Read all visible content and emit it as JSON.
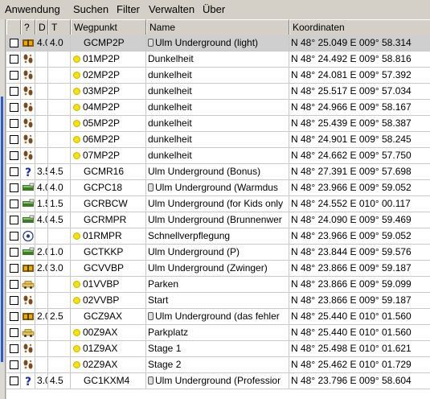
{
  "menu": [
    "Anwendung",
    "Suchen",
    "Filter",
    "Verwalten",
    "Über"
  ],
  "columns": [
    "?",
    "D",
    "T",
    "Wegpunkt",
    "Name",
    "Koordinaten"
  ],
  "rows": [
    {
      "icon": "traditional-cache-icon",
      "d": "4.0",
      "t": "4.0",
      "dot": false,
      "lock": true,
      "wp": "GCMP2P",
      "name": "Ulm Underground (light)",
      "coord": "N 48° 25.049 E 009° 58.314",
      "selected": true
    },
    {
      "icon": "footprints-icon",
      "d": "",
      "t": "",
      "dot": true,
      "lock": false,
      "wp": "01MP2P",
      "name": "Dunkelheit",
      "coord": "N 48° 24.492 E 009° 58.816",
      "selected": false
    },
    {
      "icon": "footprints-icon",
      "d": "",
      "t": "",
      "dot": true,
      "lock": false,
      "wp": "02MP2P",
      "name": "dunkelheit",
      "coord": "N 48° 24.081 E 009° 57.392",
      "selected": false
    },
    {
      "icon": "footprints-icon",
      "d": "",
      "t": "",
      "dot": true,
      "lock": false,
      "wp": "03MP2P",
      "name": "dunkelheit",
      "coord": "N 48° 25.517 E 009° 57.034",
      "selected": false
    },
    {
      "icon": "footprints-icon",
      "d": "",
      "t": "",
      "dot": true,
      "lock": false,
      "wp": "04MP2P",
      "name": "dunkelheit",
      "coord": "N 48° 24.966 E 009° 58.167",
      "selected": false
    },
    {
      "icon": "footprints-icon",
      "d": "",
      "t": "",
      "dot": true,
      "lock": false,
      "wp": "05MP2P",
      "name": "dunkelheit",
      "coord": "N 48° 25.439 E 009° 58.387",
      "selected": false
    },
    {
      "icon": "footprints-icon",
      "d": "",
      "t": "",
      "dot": true,
      "lock": false,
      "wp": "06MP2P",
      "name": "dunkelheit",
      "coord": "N 48° 24.901 E 009° 58.245",
      "selected": false
    },
    {
      "icon": "footprints-icon",
      "d": "",
      "t": "",
      "dot": true,
      "lock": false,
      "wp": "07MP2P",
      "name": "dunkelheit",
      "coord": "N 48° 24.662 E 009° 57.750",
      "selected": false
    },
    {
      "icon": "mystery-cache-icon",
      "d": "3.5",
      "t": "4.5",
      "dot": false,
      "lock": false,
      "wp": "GCMR16",
      "name": "Ulm Underground (Bonus)",
      "coord": "N 48° 27.391 E 009° 57.698",
      "selected": false
    },
    {
      "icon": "multi-cache-icon",
      "d": "4.0",
      "t": "4.0",
      "dot": false,
      "lock": true,
      "wp": "GCPC18",
      "name": "Ulm Underground (Warmdus",
      "coord": "N 48° 23.966 E 009° 59.052",
      "selected": false
    },
    {
      "icon": "multi-cache-icon",
      "d": "1.5",
      "t": "1.5",
      "dot": false,
      "lock": false,
      "wp": "GCRBCW",
      "name": "Ulm Underground (for Kids only",
      "coord": "N 48° 24.552 E 010° 00.117",
      "selected": false
    },
    {
      "icon": "multi-cache-icon",
      "d": "4.0",
      "t": "4.5",
      "dot": false,
      "lock": false,
      "wp": "GCRMPR",
      "name": "Ulm Underground (Brunnenwer",
      "coord": "N 48° 24.090 E 009° 59.469",
      "selected": false
    },
    {
      "icon": "reference-point-icon",
      "d": "",
      "t": "",
      "dot": true,
      "lock": false,
      "wp": "01RMPR",
      "name": "Schnellverpflegung",
      "coord": "N 48° 23.966 E 009° 59.052",
      "selected": false
    },
    {
      "icon": "multi-cache-icon",
      "d": "2.0",
      "t": "1.0",
      "dot": false,
      "lock": false,
      "wp": "GCTKKP",
      "name": "Ulm Underground (P)",
      "coord": "N 48° 23.844 E 009° 59.576",
      "selected": false
    },
    {
      "icon": "traditional-cache-icon",
      "d": "2.0",
      "t": "3.0",
      "dot": false,
      "lock": false,
      "wp": "GCVVBP",
      "name": "Ulm Underground (Zwinger)",
      "coord": "N 48° 23.866 E 009° 59.187",
      "selected": false
    },
    {
      "icon": "parking-car-icon",
      "d": "",
      "t": "",
      "dot": true,
      "lock": false,
      "wp": "01VVBP",
      "name": "Parken",
      "coord": "N 48° 23.866 E 009° 59.099",
      "selected": false
    },
    {
      "icon": "footprints-icon",
      "d": "",
      "t": "",
      "dot": true,
      "lock": false,
      "wp": "02VVBP",
      "name": "Start",
      "coord": "N 48° 23.866 E 009° 59.187",
      "selected": false
    },
    {
      "icon": "traditional-cache-icon",
      "d": "2.0",
      "t": "2.5",
      "dot": false,
      "lock": true,
      "wp": "GCZ9AX",
      "name": "Ulm Underground (das fehler",
      "coord": "N 48° 25.440 E 010° 01.560",
      "selected": false
    },
    {
      "icon": "parking-car-icon",
      "d": "",
      "t": "",
      "dot": true,
      "lock": false,
      "wp": "00Z9AX",
      "name": "Parkplatz",
      "coord": "N 48° 25.440 E 010° 01.560",
      "selected": false
    },
    {
      "icon": "footprints-icon",
      "d": "",
      "t": "",
      "dot": true,
      "lock": false,
      "wp": "01Z9AX",
      "name": "Stage 1",
      "coord": "N 48° 25.498 E 010° 01.621",
      "selected": false
    },
    {
      "icon": "footprints-icon",
      "d": "",
      "t": "",
      "dot": true,
      "lock": false,
      "wp": "02Z9AX",
      "name": "Stage 2",
      "coord": "N 48° 25.462 E 010° 01.729",
      "selected": false
    },
    {
      "icon": "mystery-cache-icon",
      "d": "3.0",
      "t": "4.5",
      "dot": false,
      "lock": true,
      "wp": "GC1KXM4",
      "name": "Ulm Underground (Professior",
      "coord": "N 48° 23.796 E 009° 58.604",
      "selected": false
    }
  ]
}
